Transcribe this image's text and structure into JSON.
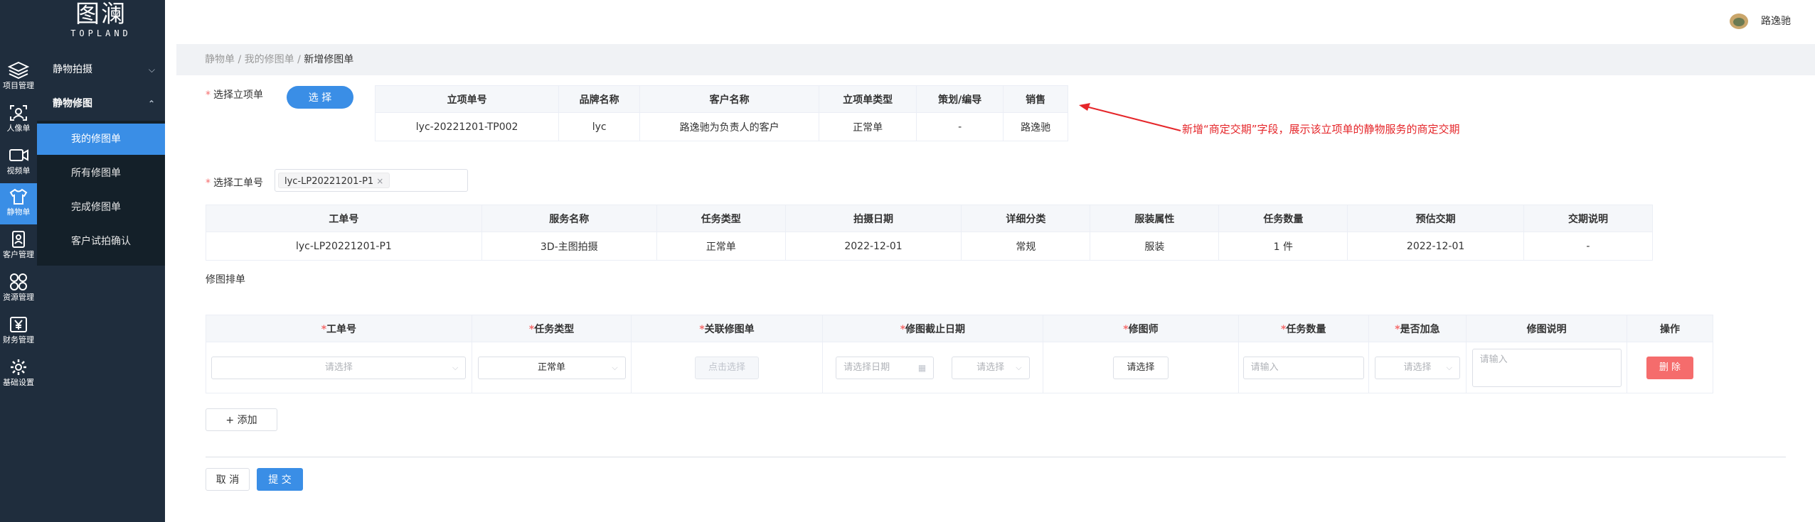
{
  "brand": {
    "name": "图澜",
    "sub": "TOPLAND"
  },
  "user": {
    "name": "路逸驰"
  },
  "rail": [
    {
      "label": "项目管理",
      "icon": "layers-icon"
    },
    {
      "label": "人像单",
      "icon": "portrait-icon"
    },
    {
      "label": "视频单",
      "icon": "video-icon"
    },
    {
      "label": "静物单",
      "icon": "shirt-icon"
    },
    {
      "label": "客户管理",
      "icon": "contact-icon"
    },
    {
      "label": "资源管理",
      "icon": "grid-icon"
    },
    {
      "label": "财务管理",
      "icon": "yen-icon"
    },
    {
      "label": "基础设置",
      "icon": "gear-icon"
    }
  ],
  "sidebar": {
    "groups": [
      {
        "label": "静物拍摄",
        "chevron": "chevron-down-icon"
      },
      {
        "label": "静物修图",
        "chevron": "chevron-up-icon"
      }
    ],
    "items": [
      "我的修图单",
      "所有修图单",
      "完成修图单",
      "客户试拍确认"
    ]
  },
  "breadcrumb": {
    "items": [
      "静物单",
      "我的修图单"
    ],
    "current": "新增修图单"
  },
  "project": {
    "label": "选择立项单",
    "button": "选 择",
    "headers": [
      "立项单号",
      "品牌名称",
      "客户名称",
      "立项单类型",
      "策划/编导",
      "销售"
    ],
    "row": [
      "lyc-20221201-TP002",
      "lyc",
      "路逸驰为负责人的客户",
      "正常单",
      "-",
      "路逸驰"
    ]
  },
  "annotation": "新增“商定交期”字段，展示该立项单的静物服务的商定交期",
  "workorder": {
    "label": "选择工单号",
    "tag": "lyc-LP20221201-P1",
    "headers": [
      "工单号",
      "服务名称",
      "任务类型",
      "拍摄日期",
      "详细分类",
      "服装属性",
      "任务数量",
      "预估交期",
      "交期说明"
    ],
    "row": [
      "lyc-LP20221201-P1",
      "3D-主图拍摄",
      "正常单",
      "2022-12-01",
      "常规",
      "服装",
      "1 件",
      "2022-12-01",
      "-"
    ]
  },
  "retouch": {
    "label": "修图排单",
    "headers": [
      {
        "req": "*",
        "text": "工单号"
      },
      {
        "req": "*",
        "text": "任务类型"
      },
      {
        "req": "*",
        "text": "关联修图单"
      },
      {
        "req": "*",
        "text": "修图截止日期"
      },
      {
        "req": "*",
        "text": "修图师"
      },
      {
        "req": "*",
        "text": "任务数量"
      },
      {
        "req": "*",
        "text": "是否加急"
      },
      {
        "req": "",
        "text": "修图说明"
      },
      {
        "req": "",
        "text": "操作"
      }
    ],
    "row": {
      "workorder_placeholder": "请选择",
      "task_type": "正常单",
      "link_button": "点击选择",
      "date_placeholder": "请选择日期",
      "time_placeholder": "请选择",
      "retoucher_button": "请选择",
      "qty_placeholder": "请输入",
      "urgent_placeholder": "请选择",
      "note_placeholder": "请输入",
      "delete_button": "删 除"
    },
    "add_button": "+ 添加"
  },
  "footer": {
    "cancel": "取 消",
    "submit": "提 交"
  },
  "colors": {
    "sidebar": "#1f2d3d",
    "primary": "#3a8ee6",
    "danger": "#f56c6c",
    "annotation": "#e5262a"
  }
}
